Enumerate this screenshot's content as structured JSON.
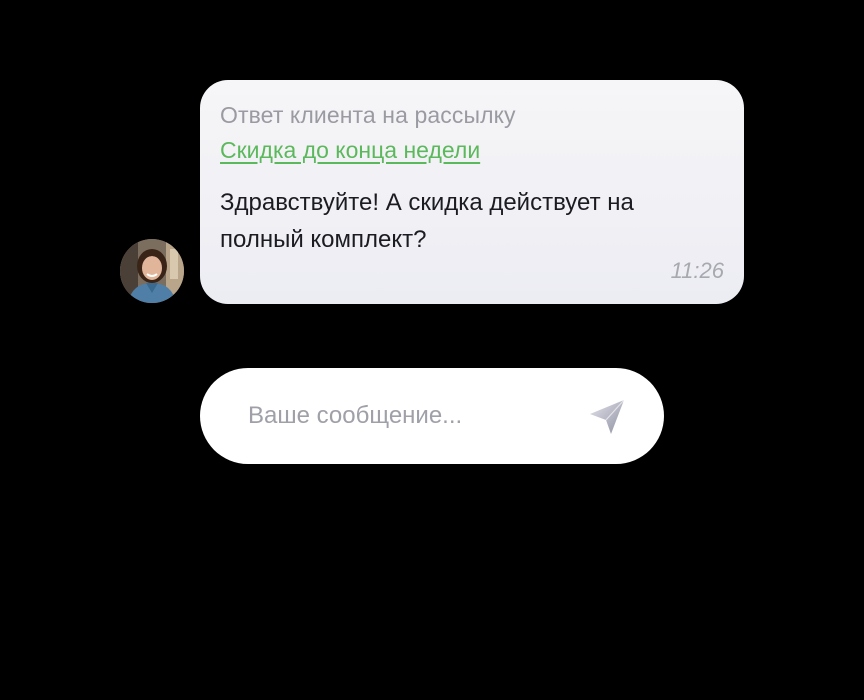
{
  "message": {
    "reply_label": "Ответ клиента на рассылку",
    "campaign_link": "Скидка до конца недели",
    "text": "Здравствуйте! А скидка действует на полный комплект?",
    "time": "11:26",
    "avatar_icon": "user-photo-icon"
  },
  "composer": {
    "placeholder": "Ваше сообщение...",
    "value": "",
    "send_icon": "send-icon"
  },
  "colors": {
    "background": "#000000",
    "bubble": "#f2f2f6",
    "link": "#5cb85c",
    "muted_text": "#9a9aa2"
  }
}
